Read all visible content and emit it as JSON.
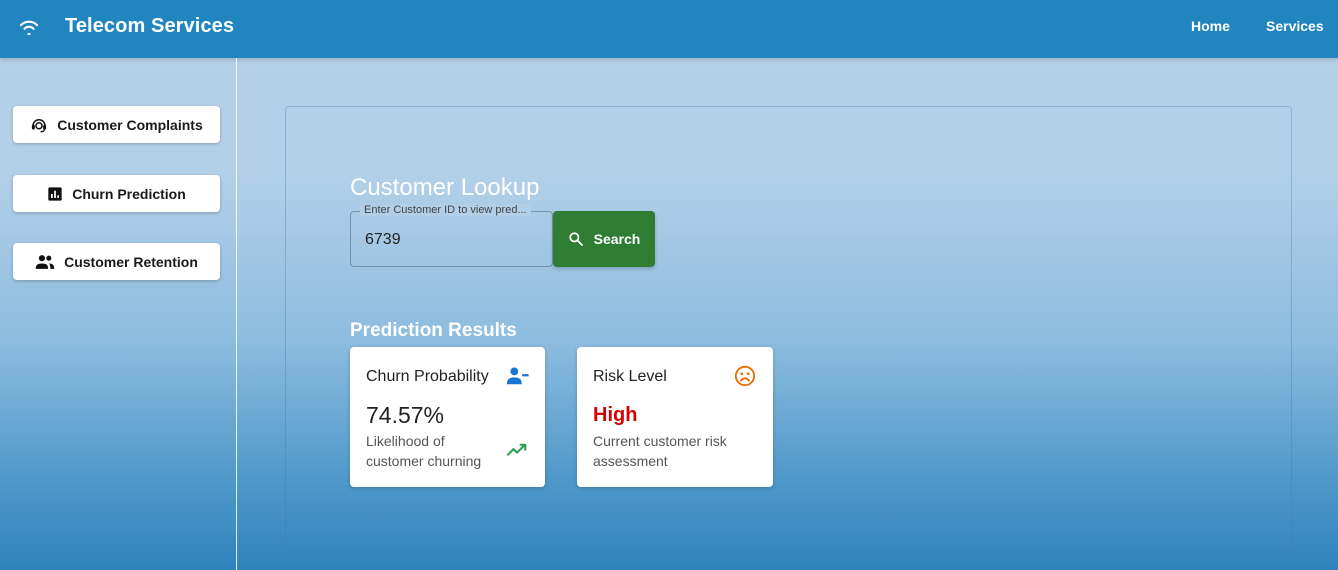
{
  "app": {
    "title": "Telecom Services"
  },
  "nav": {
    "home": "Home",
    "services": "Services"
  },
  "sidebar": {
    "items": [
      {
        "label": "Customer Complaints",
        "icon": "support-agent-icon"
      },
      {
        "label": "Churn Prediction",
        "icon": "bar-chart-icon"
      },
      {
        "label": "Customer Retention",
        "icon": "people-icon"
      }
    ]
  },
  "lookup": {
    "title": "Customer Lookup",
    "field_label": "Enter Customer ID to view pred...",
    "field_value": "6739",
    "search_label": "Search"
  },
  "results": {
    "title": "Prediction Results",
    "cards": [
      {
        "title": "Churn Probability",
        "value": "74.57%",
        "description": "Likelihood of customer churning",
        "icon": "person-remove-icon",
        "trend_icon": "trending-up-icon"
      },
      {
        "title": "Risk Level",
        "value": "High",
        "description": "Current customer risk assessment",
        "icon": "sad-face-icon"
      }
    ]
  },
  "colors": {
    "appbar": "#2185c0",
    "search_button": "#2e7d32",
    "risk_high": "#d50000",
    "person_icon": "#1976d2",
    "sad_icon": "#ef6c00",
    "trend_icon": "#2e9e4f"
  }
}
